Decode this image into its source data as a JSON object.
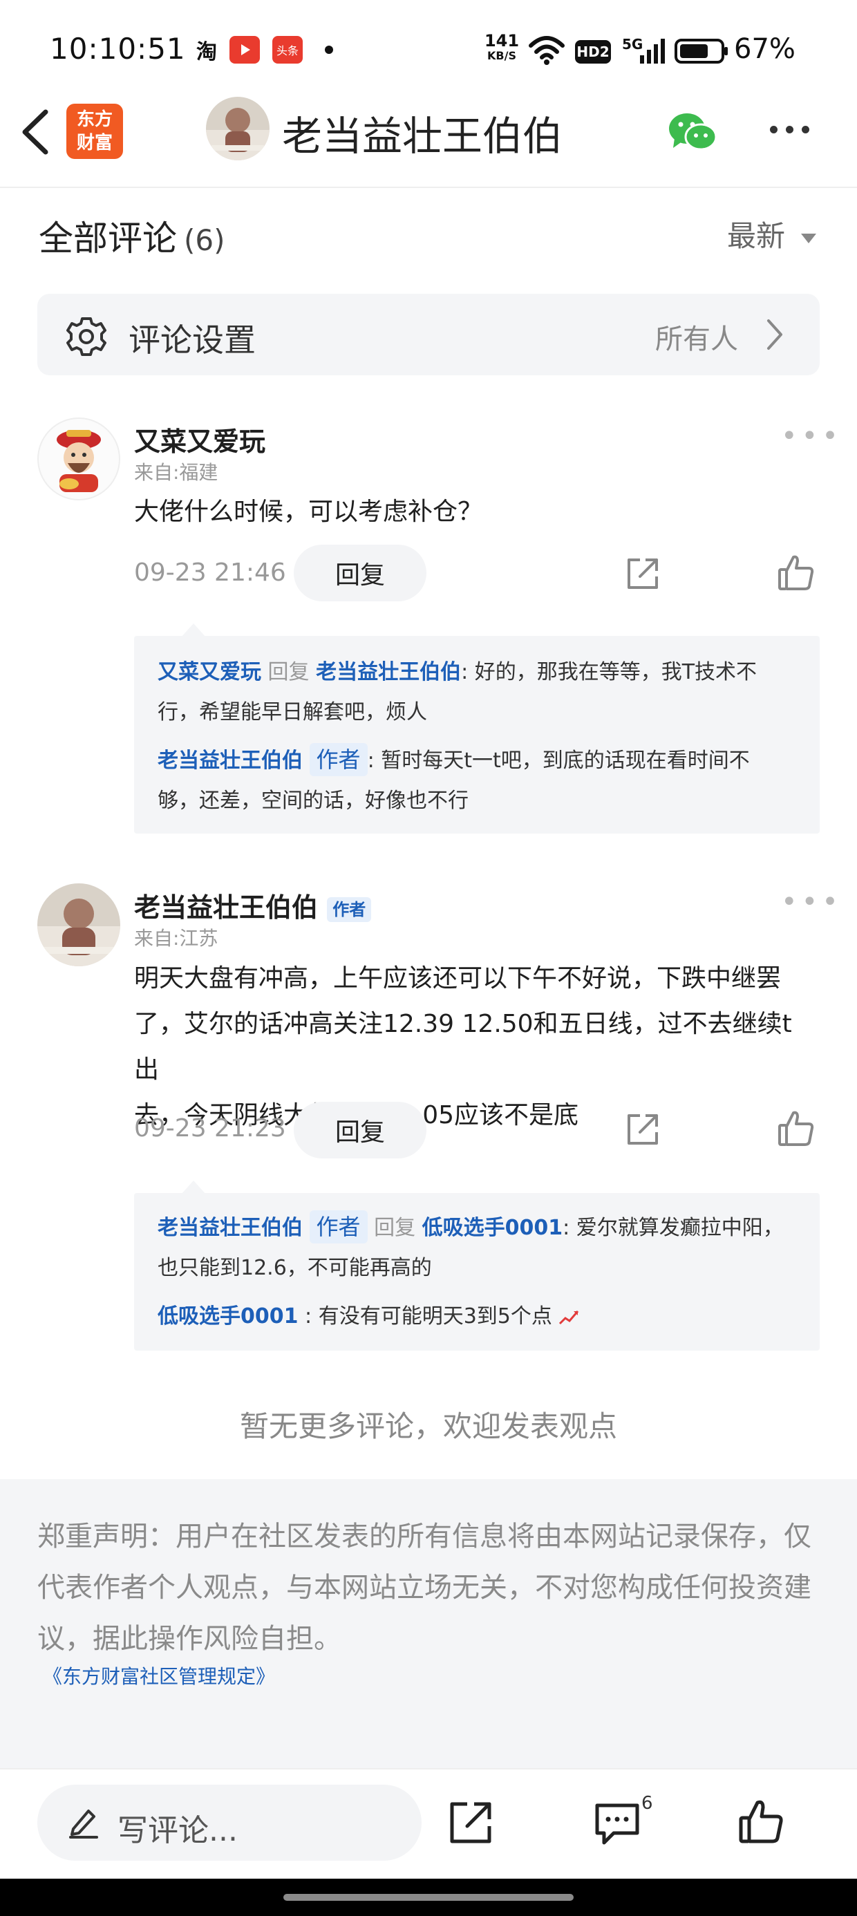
{
  "status_bar": {
    "time": "10:10:51",
    "app_icons": [
      "淘",
      "头条"
    ],
    "net_speed_value": "141",
    "net_speed_unit": "KB/S",
    "hd_label": "HD2",
    "signal_label": "5G",
    "battery": "67%"
  },
  "nav": {
    "brand_line1": "东方",
    "brand_line2": "财富",
    "title": "老当益壮王伯伯",
    "wechat_icon": "wechat-icon",
    "more_icon": "more-icon"
  },
  "section": {
    "title": "全部评论",
    "count": "(6)",
    "sort": "最新"
  },
  "settings": {
    "label": "评论设置",
    "value": "所有人"
  },
  "comments": [
    {
      "user": "又菜又爱玩",
      "location": "来自:福建",
      "text_lines": [
        "大佬什么时候，可以考虑补仓？"
      ],
      "time": "09-23 21:46",
      "reply_label": "回复",
      "replies": [
        {
          "from": "又菜又爱玩",
          "verb": "回复",
          "to": "老当益壮王伯伯",
          "line1": ": 好的，那我在等等，我T技术不",
          "line2": "行，希望能早日解套吧，烦人"
        },
        {
          "from": "老当益壮王伯伯",
          "tag": "作者",
          "line1": ": 暂时每天t一t吧，到底的话现在看时间不",
          "line2": "够，还差，空间的话，好像也不行"
        }
      ]
    },
    {
      "user": "老当益壮王伯伯",
      "tag": "作者",
      "location": "来自:江苏",
      "text_lines": [
        "明天大盘有冲高，上午应该还可以下午不好说，下跌中继罢",
        "了，艾尔的话冲高关注12.39 12.50和五日线，过不去继续t出",
        "去，今天阴线大长腿的12.05应该不是底"
      ],
      "time": "09-23 21:23",
      "reply_label": "回复",
      "replies": [
        {
          "from": "老当益壮王伯伯",
          "tag": "作者",
          "verb": "回复",
          "to": "低吸选手0001",
          "line1": ": 爱尔就算发癫拉中阳，",
          "line2": "也只能到12.6，不可能再高的"
        },
        {
          "from": "低吸选手0001",
          "line1": ": 有没有可能明天3到5个点"
        }
      ]
    }
  ],
  "no_more": "暂无更多评论，欢迎发表观点",
  "disclaimer": "郑重声明：用户在社区发表的所有信息将由本网站记录保存，仅代表作者个人观点，与本网站立场无关，不对您构成任何投资建议，据此操作风险自担。",
  "rules_link": "《东方财富社区管理规定》",
  "bottom": {
    "write_placeholder": "写评论...",
    "comment_count": "6"
  },
  "colors": {
    "brand": "#f15a22",
    "link_blue": "#1d5fb8",
    "wechat_green": "#3dbb4e",
    "panel_gray": "#f4f5f7"
  }
}
